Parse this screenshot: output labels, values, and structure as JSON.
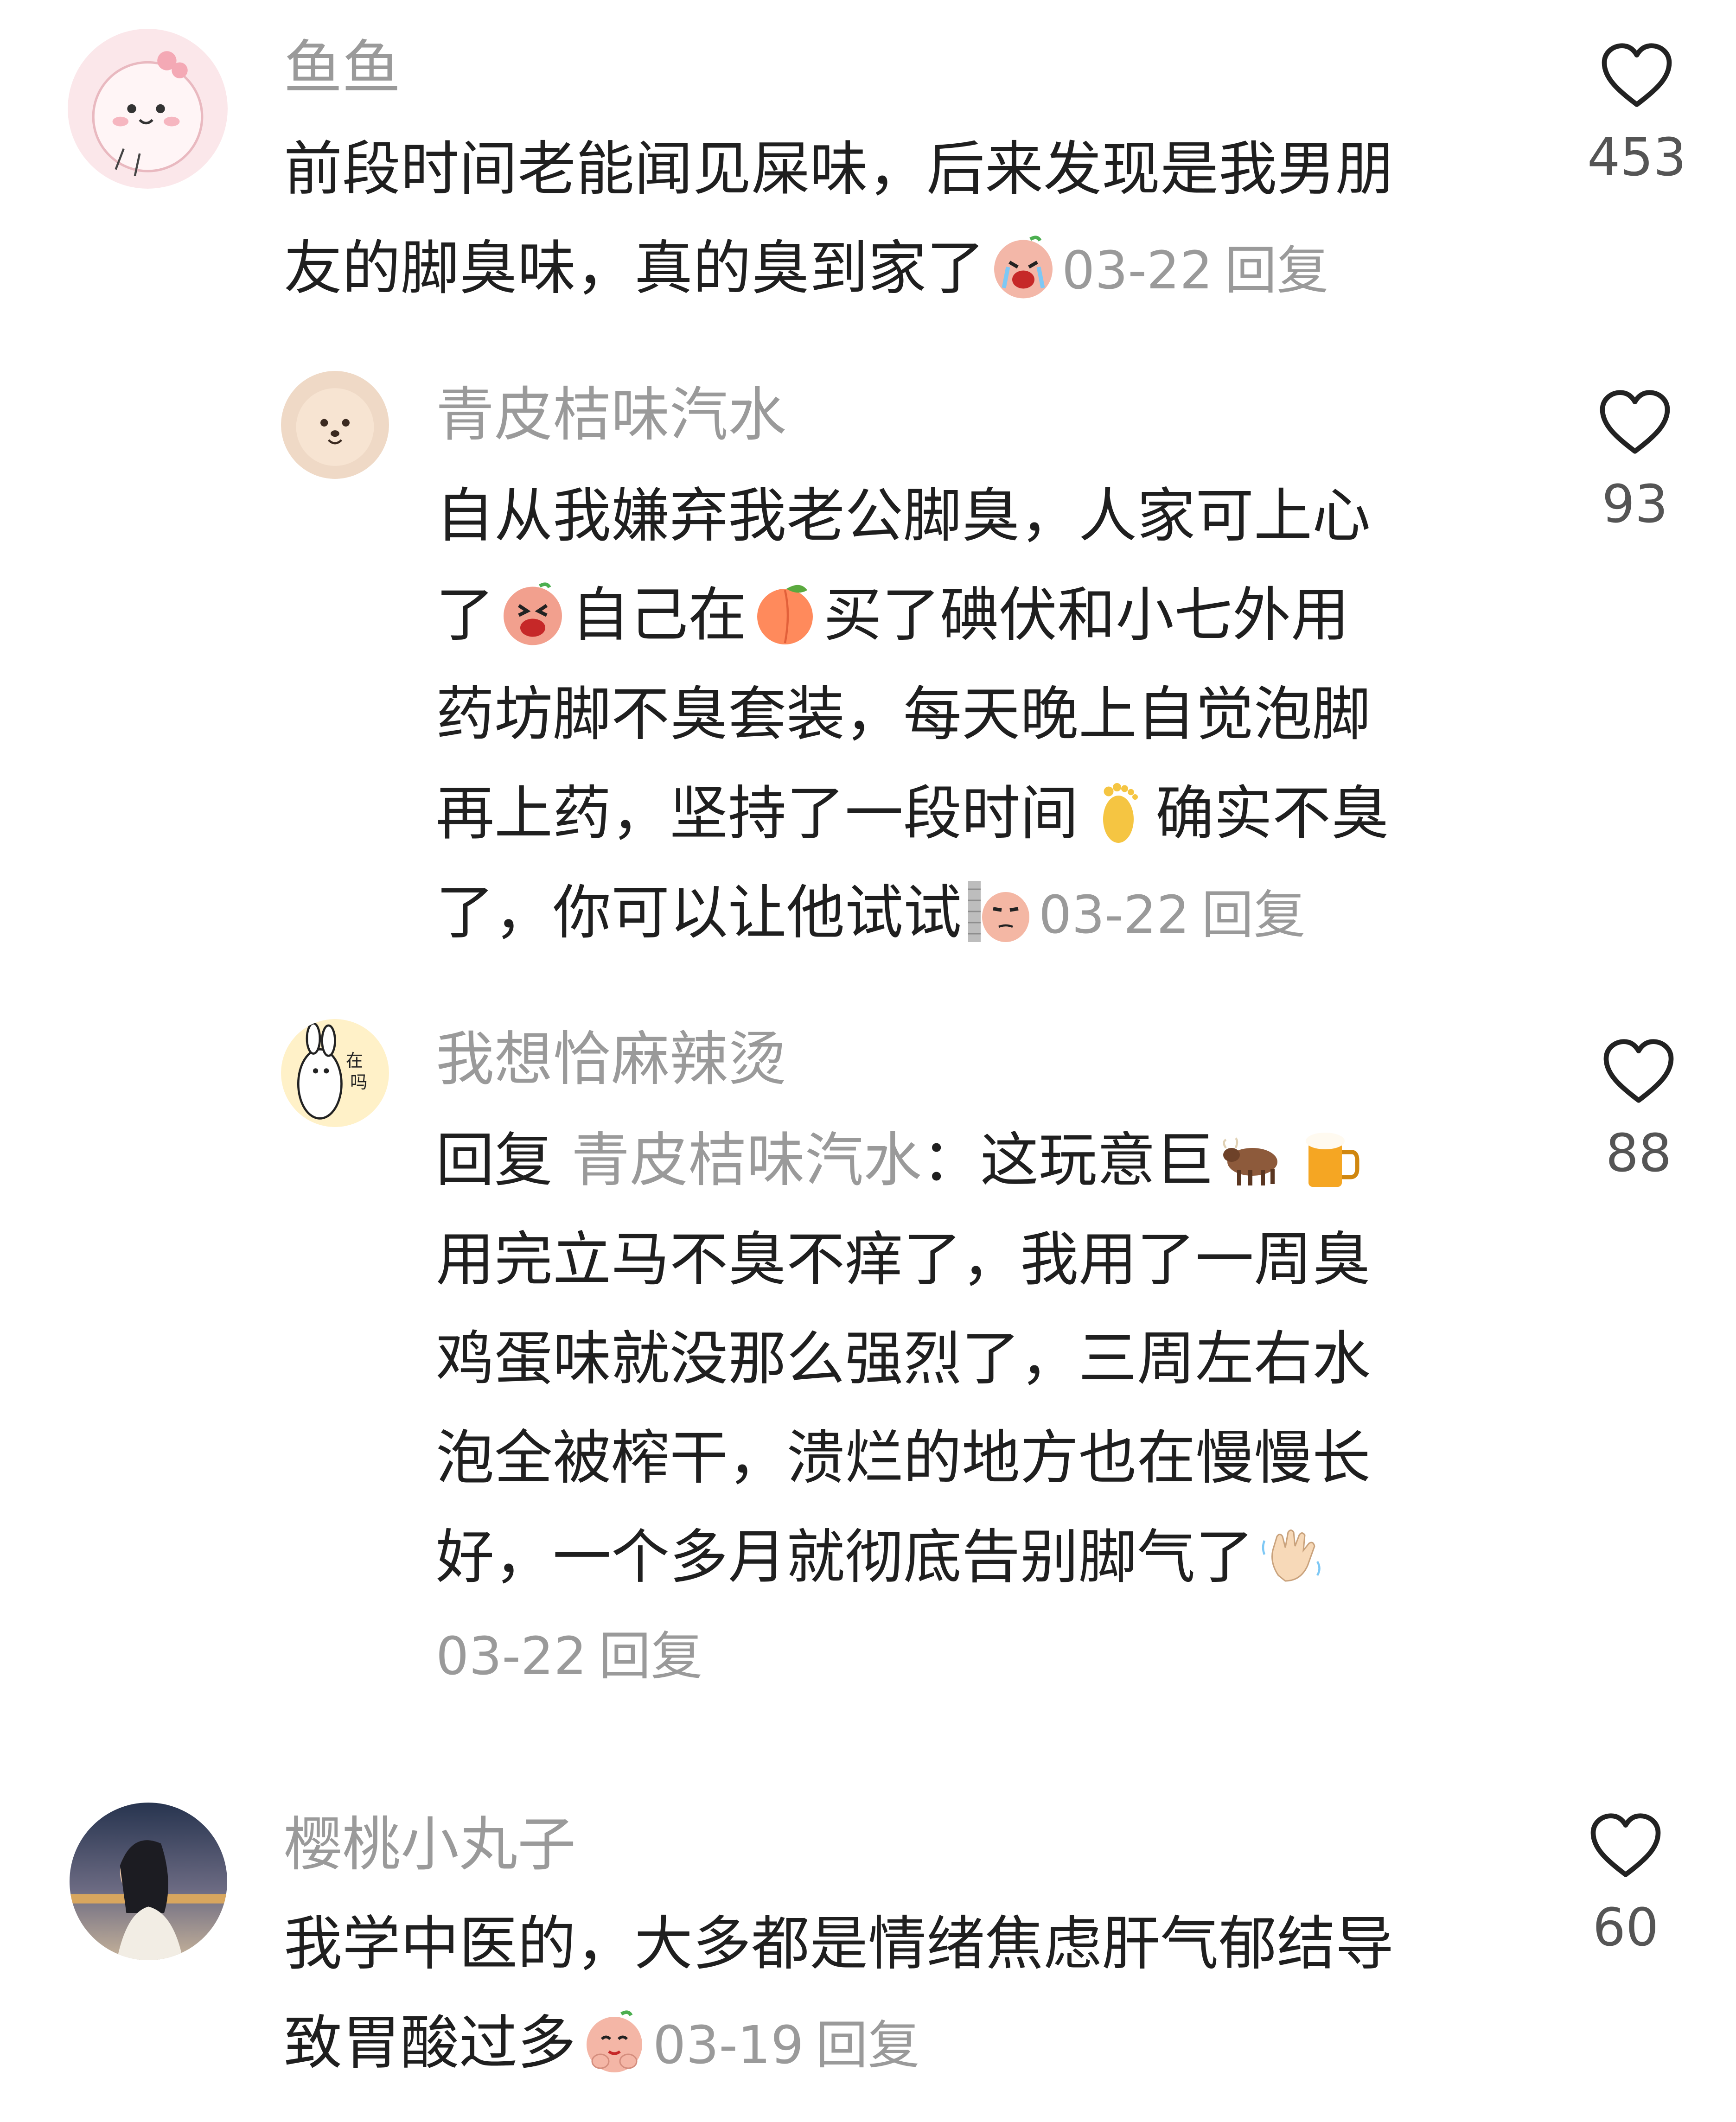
{
  "comments": [
    {
      "username": "鱼鱼",
      "lines": [
        "前段时间老能闻见屎味，后来发现是我男朋",
        "友的脚臭味，真的臭到家了"
      ],
      "emoji_after_text": "crying-face-emoji",
      "date": "03-22",
      "reply_label": "回复",
      "likes": "453",
      "avatar": "pink-cartoon-avatar"
    },
    {
      "username": "青皮桔味汽水",
      "segments": {
        "l1": "自从我嫌弃我老公脚臭，人家可上心",
        "l2a": "了",
        "l2b": "自己在",
        "l2c": "买了碘伏和小七外用",
        "l3": "药坊脚不臭套装，每天晚上自觉泡脚",
        "l4a": "再上药，坚持了一段时间",
        "l4b": "确实不臭",
        "l5": "了，你可以让他试试"
      },
      "emojis": [
        "laughing-emoji",
        "peach-emoji",
        "foot-emoji",
        "peek-emoji"
      ],
      "date": "03-22",
      "reply_label": "回复",
      "likes": "93",
      "avatar": "puppy-avatar"
    },
    {
      "username": "我想恰麻辣烫",
      "segments": {
        "reply_prefix": "回复",
        "reply_to": "青皮桔味汽水",
        "l1a": "：这玩意巨",
        "l2": "用完立马不臭不痒了，我用了一周臭",
        "l3": "鸡蛋味就没那么强烈了，三周左右水",
        "l4": "泡全被榨干，溃烂的地方也在慢慢长",
        "l5": "好，一个多月就彻底告别脚气了"
      },
      "emojis": [
        "ox-emoji",
        "beer-emoji",
        "waving-hand-emoji"
      ],
      "date": "03-22",
      "reply_label": "回复",
      "likes": "88",
      "avatar": "bunny-avatar"
    },
    {
      "username": "樱桃小丸子",
      "lines": [
        "我学中医的，大多都是情绪焦虑肝气郁结导",
        "致胃酸过多"
      ],
      "emoji_after_text": "pleading-emoji",
      "date": "03-19",
      "reply_label": "回复",
      "likes": "60",
      "avatar": "photo-avatar"
    }
  ],
  "colors": {
    "text": "#1f1f1f",
    "secondary": "#9a9a9a",
    "like_count": "#555555",
    "background": "#ffffff"
  }
}
